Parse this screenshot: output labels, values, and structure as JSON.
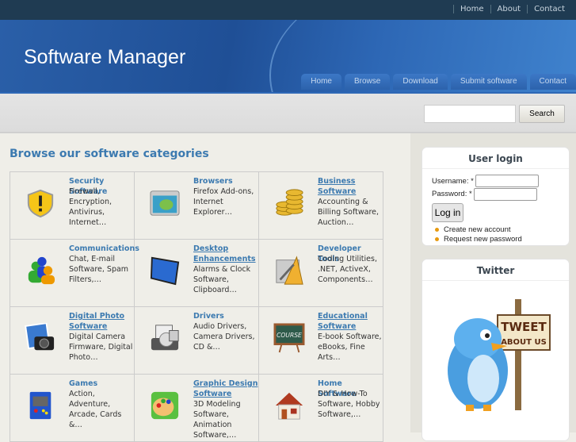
{
  "top_links": [
    "Home",
    "About",
    "Contact"
  ],
  "site_title": "Software Manager",
  "nav": [
    "Home",
    "Browse",
    "Download",
    "Submit software",
    "Contact"
  ],
  "search": {
    "button": "Search",
    "value": ""
  },
  "main": {
    "heading": "Browse our software categories",
    "categories": [
      {
        "name": "Security Software",
        "desc": "Firewall, Encryption, Antivirus, Internet…",
        "icon": "shield-icon",
        "lines": 1,
        "u": false
      },
      {
        "name": "Browsers",
        "desc": "Firefox Add-ons, Internet Explorer…",
        "icon": "browser-icon",
        "lines": 1,
        "u": false
      },
      {
        "name": "Business Software",
        "desc": "Accounting & Billing Software, Auction…",
        "icon": "coins-icon",
        "lines": 2,
        "u": true
      },
      {
        "name": "Communications",
        "desc": "Chat, E-mail Software, Spam Filters,…",
        "icon": "users-icon",
        "lines": 1,
        "u": false
      },
      {
        "name": "Desktop Enhancements",
        "desc": "Alarms & Clock Software, Clipboard…",
        "icon": "desktop-icon",
        "lines": 2,
        "u": true
      },
      {
        "name": "Developer Tools",
        "desc": "Coding Utilities, .NET, ActiveX, Components…",
        "icon": "tools-icon",
        "lines": 1,
        "u": false
      },
      {
        "name": "Digital Photo Software",
        "desc": "Digital Camera Firmware, Digital Photo…",
        "icon": "camera-icon",
        "lines": 2,
        "u": true
      },
      {
        "name": "Drivers",
        "desc": "Audio Drivers, Camera Drivers, CD &…",
        "icon": "drivers-icon",
        "lines": 1,
        "u": false
      },
      {
        "name": "Educational Software",
        "desc": "E-book Software, eBooks, Fine Arts…",
        "icon": "chalkboard-icon",
        "lines": 2,
        "u": true
      },
      {
        "name": "Games",
        "desc": "Action, Adventure, Arcade, Cards &…",
        "icon": "arcade-icon",
        "lines": 1,
        "u": false
      },
      {
        "name": "Graphic Design Software",
        "desc": "3D Modeling Software, Animation Software,…",
        "icon": "palette-icon",
        "lines": 2,
        "u": true
      },
      {
        "name": "Home Software",
        "desc": "DIY & How-To Software, Hobby Software,…",
        "icon": "house-icon",
        "lines": 1,
        "u": false
      }
    ]
  },
  "login": {
    "title": "User login",
    "username_label": "Username: *",
    "password_label": "Password: *",
    "button": "Log in",
    "links": [
      "Create new account",
      "Request new password"
    ]
  },
  "twitter": {
    "title": "Twitter",
    "badge": "TWEET ABOUT US"
  },
  "colors": {
    "link": "#3c7ab0",
    "header": "#2a5fa8",
    "bullet": "#e79a10"
  }
}
